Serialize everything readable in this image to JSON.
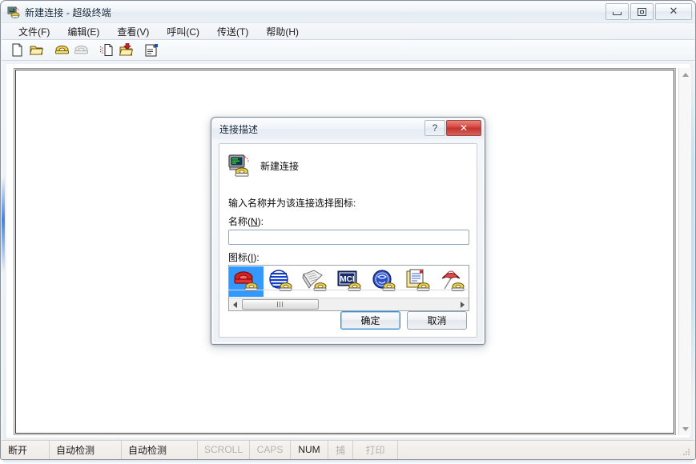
{
  "window": {
    "title": "新建连接 - 超级终端",
    "icon": "hyperterminal-icon",
    "controls": {
      "minimize": "minimize-button",
      "maximize": "maximize-button",
      "close": "close-button",
      "close_glyph": "✕"
    }
  },
  "menubar": {
    "items": [
      {
        "label": "文件(F)",
        "name": "menu-file"
      },
      {
        "label": "编辑(E)",
        "name": "menu-edit"
      },
      {
        "label": "查看(V)",
        "name": "menu-view"
      },
      {
        "label": "呼叫(C)",
        "name": "menu-call"
      },
      {
        "label": "传送(T)",
        "name": "menu-transfer"
      },
      {
        "label": "帮助(H)",
        "name": "menu-help"
      }
    ]
  },
  "toolbar": {
    "buttons": [
      {
        "name": "new-connection-icon",
        "title": "新建连接"
      },
      {
        "name": "open-folder-icon",
        "title": "打开"
      },
      {
        "name": "call-phone-icon",
        "title": "呼叫"
      },
      {
        "name": "disconnect-phone-icon",
        "title": "断开",
        "disabled": true
      },
      {
        "name": "send-file-icon",
        "title": "发送文件"
      },
      {
        "name": "receive-file-icon",
        "title": "接收文件"
      },
      {
        "name": "properties-icon",
        "title": "属性"
      }
    ]
  },
  "terminal": {
    "content": "",
    "scrollbar": {
      "up": "scroll-up-arrow",
      "down": "scroll-down-arrow"
    }
  },
  "statusbar": {
    "cells": [
      {
        "label": "断开",
        "name": "status-connection",
        "state": "normal"
      },
      {
        "label": "自动检测",
        "name": "status-autodetect-1",
        "state": "normal"
      },
      {
        "label": "自动检测",
        "name": "status-autodetect-2",
        "state": "normal"
      },
      {
        "label": "SCROLL",
        "name": "status-scroll",
        "state": "dim"
      },
      {
        "label": "CAPS",
        "name": "status-caps",
        "state": "dim"
      },
      {
        "label": "NUM",
        "name": "status-num",
        "state": "active"
      },
      {
        "label": "捕",
        "name": "status-capture",
        "state": "dim"
      },
      {
        "label": "打印",
        "name": "status-print",
        "state": "dim"
      }
    ]
  },
  "dialog": {
    "title": "连接描述",
    "help_glyph": "?",
    "close_glyph": "✕",
    "header_label": "新建连接",
    "header_icon": "new-connection-large-icon",
    "prompt": "输入名称并为该连接选择图标:",
    "name_label_prefix": "名称(",
    "name_label_accel": "N",
    "name_label_suffix": "):",
    "name_value": "",
    "name_placeholder": "",
    "icon_label_prefix": "图标(",
    "icon_label_accel": "I",
    "icon_label_suffix": "):",
    "icons": [
      {
        "name": "icon-red-phone",
        "selected": true
      },
      {
        "name": "icon-blue-globe",
        "selected": false
      },
      {
        "name": "icon-newspaper",
        "selected": false
      },
      {
        "name": "icon-mci",
        "selected": false
      },
      {
        "name": "icon-ge-globe",
        "selected": false
      },
      {
        "name": "icon-documents",
        "selected": false
      },
      {
        "name": "icon-umbrella",
        "selected": false
      }
    ],
    "scroll_left": "scroll-left-arrow",
    "scroll_right": "scroll-right-arrow",
    "ok_label": "确定",
    "cancel_label": "取消"
  },
  "colors": {
    "selection_blue": "#3399ff",
    "close_red": "#c0342d",
    "default_button_border": "#3c8fcf",
    "title_text": "#14263d"
  }
}
